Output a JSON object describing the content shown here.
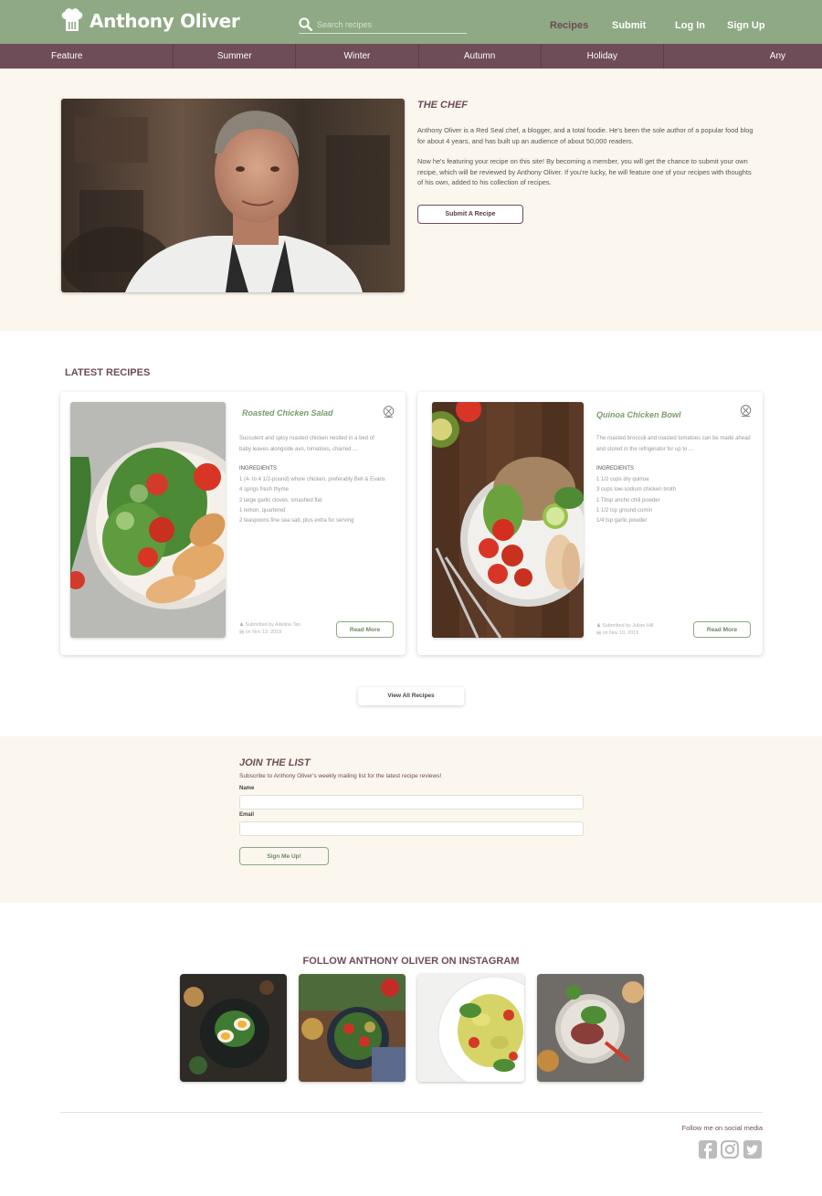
{
  "header": {
    "brand": "Anthony Oliver",
    "search_placeholder": "Search recipes",
    "nav": [
      "Recipes",
      "Submit",
      "Log In",
      "Sign Up"
    ]
  },
  "categories": [
    "Feature",
    "Summer",
    "Winter",
    "Autumn",
    "Holiday",
    "Any"
  ],
  "chef": {
    "title": "THE CHEF",
    "paragraph1": "Anthony Oliver is a Red Seal chef, a blogger, and a total foodie. He's been the sole author of a popular food blog for about 4 years, and has built up an audience of about 50,000 readers.",
    "paragraph2": "Now he's featuring your recipe on this site! By becoming a member, you will get the chance to submit your own recipe, which will be reviewed by Anthony Oliver. If you're lucky, he will feature one of your recipes with thoughts of his own, added to his collection of recipes.",
    "button": "Submit A Recipe"
  },
  "latest": {
    "title": "LATEST RECIPES",
    "cards": [
      {
        "title": "Roasted Chicken Salad",
        "description": "Succulent and spicy roasted chicken nestled in a bed of baby leaves alongside avo, tomatoes, charred ...",
        "ingredients_title": "INGREDIENTS",
        "ingredients": [
          "1 (4- to 4 1/2-pound) whole chicken, preferably Bell & Evans",
          "4 sprigs fresh thyme",
          "2 large garlic cloves, smashed flat",
          "1 lemon, quartered",
          "2 teaspoons fine sea salt, plus extra for serving"
        ],
        "submitted_by": "Submitted by Adelina Tan",
        "date": "on Nov 13, 2019",
        "button": "Read More"
      },
      {
        "title": "Quinoa Chicken Bowl",
        "description": "The roasted broccoli and roasted tomatoes can be made ahead and stored in the refrigerator for up to ...",
        "ingredients_title": "INGREDIENTS",
        "ingredients": [
          "1 1/2 cups dry quinoa",
          "3 cups low-sodium chicken broth",
          "1 Tbsp ancho chili powder",
          "1 1/2 tsp ground cumin",
          "1/4 tsp garlic powder"
        ],
        "submitted_by": "Submitted by Julian Hill",
        "date": "on Nov 10, 2019",
        "button": "Read More"
      }
    ],
    "view_all": "View All Recipes"
  },
  "join": {
    "title": "JOIN THE LIST",
    "subtitle": "Subscribe to Anthony Oliver's weekly mailing list for the latest recipe reviews!",
    "name_label": "Name",
    "email_label": "Email",
    "button": "Sign Me Up!"
  },
  "instagram": {
    "title": "FOLLOW ANTHONY OLIVER ON INSTAGRAM"
  },
  "footer": {
    "social_text": "Follow me on social media",
    "icons": [
      "facebook-icon",
      "instagram-icon",
      "twitter-icon"
    ]
  },
  "colors": {
    "header_green": "#8ea983",
    "category_plum": "#6e4c58",
    "cream": "#fbf6ee",
    "accent_green_text": "#7a9b6c"
  }
}
